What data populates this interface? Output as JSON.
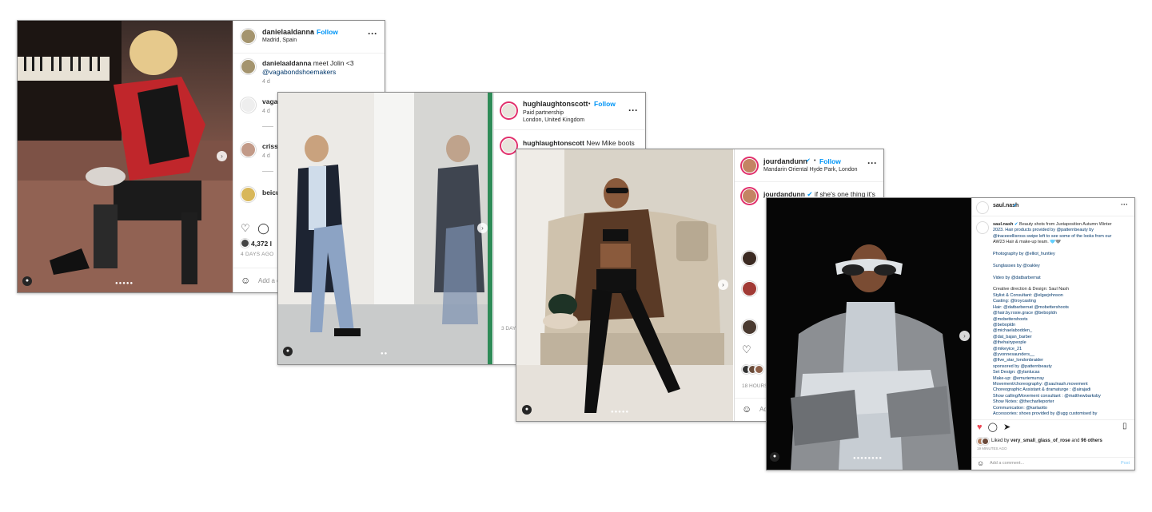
{
  "posts": [
    {
      "username": "danielaaldanna",
      "follow": "Follow",
      "location": "Madrid, Spain",
      "caption_user": "danielaaldanna",
      "caption_text": "meet Jolin <3",
      "caption_link": "@vagabondshoemakers",
      "caption_time": "4 d",
      "comments": [
        {
          "user": "vaga",
          "time": "4 d"
        },
        {
          "user": "criss",
          "time": "4 d"
        },
        {
          "user": "beicu",
          "time": ""
        }
      ],
      "likes": "4,372 l",
      "date": "4 DAYS AGO",
      "add_comment": "Add a c"
    },
    {
      "username": "hughlaughtonscott",
      "follow": "Follow",
      "paid": "Paid partnership",
      "location": "London, United Kingdom",
      "caption_user": "hughlaughtonscott",
      "caption_text": "New Mike boots",
      "date": "3 DAY"
    },
    {
      "username": "jourdandunn",
      "follow": "Follow",
      "location": "Mandarin Oriental Hyde Park, London",
      "caption_user": "jourdandunn",
      "caption_text": "if she's one thing it's",
      "date": "18 HOURS",
      "add_comment": "Ad"
    },
    {
      "username": "saul.nash",
      "caption_user": "saul.nash",
      "caption_lines": [
        "Beauty shots from Juxtaposition Autumn Winter",
        "2023. Hair products provided by @patternbeauty by",
        "@traceeellisross swipe left to see some of the looks from our",
        "AW23 Hair & make-up team. 🩵🩶",
        "",
        "Photography by @elliot_huntley",
        "",
        "Sunglasses by @oakley",
        "",
        "Video by @datbarbernat",
        "",
        "Creative direction & Design: Saul Nash",
        "Stylist & Consultant: @elgarjohnson",
        "Casting: @troycasting",
        "Hair: @datbarbernat @mobettershoots",
        "@hair.by.rosie.grace @bebopldn",
        "@mobettershoots",
        "@bebopldn",
        "@michaelabodden_",
        "@dat_bajan_barber",
        "@thehairypeople",
        "@mikeyice_21",
        "@yvonnesaunders__",
        "@five_star_londonbraider",
        "sponsored by @patternbeauty",
        "Set Design: @ylanlucas",
        "Make-up: @emuriemurray",
        "Movement/choreography: @saulnash.movement",
        "Choreographic Assistant & dramaturge : @airajadi",
        "Show calling/Movement consultant : @matthewbarksby",
        "Show Notes: @thecharlieporter",
        "Communication: @karlaotto",
        "Accessories: shoes provided by @ugg customised by"
      ],
      "likes_prefix": "Liked by",
      "likes_user": "very_small_glass_of_rose",
      "likes_mid": "and",
      "likes_others": "96 others",
      "date": "19 MINUTES AGO",
      "add_comment": "Add a comment...",
      "post_btn": "Post"
    }
  ],
  "colors": {
    "accent": "#0095f6",
    "link": "#00376b",
    "heart": "#ed4956"
  }
}
